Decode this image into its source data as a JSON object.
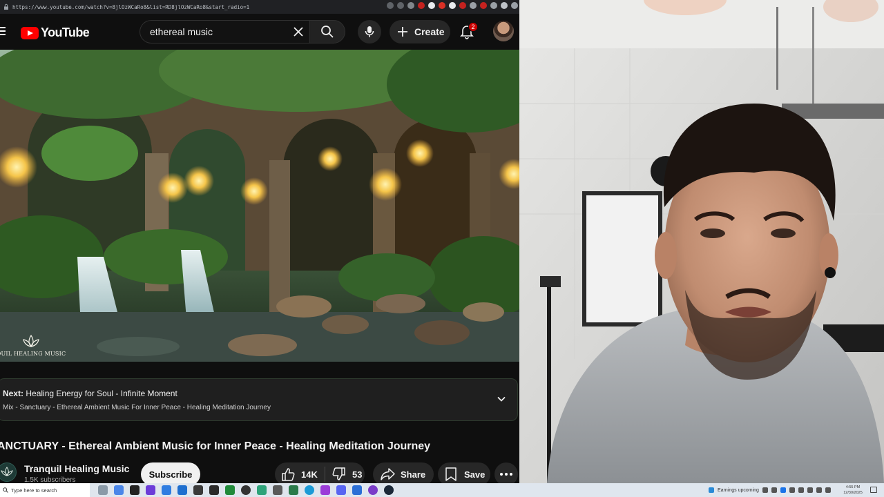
{
  "browser": {
    "url": "https://www.youtube.com/watch?v=8jlOzWCaRo8&list=RD8jlOzWCaRo8&start_radio=1"
  },
  "youtube": {
    "logo_text": "YouTube",
    "search_query": "ethereal music",
    "create_label": "Create",
    "notification_count": "2",
    "player": {
      "watermark_text": "QUIL HEALING MUSIC"
    },
    "up_next": {
      "label": "Next:",
      "title": "Healing Energy for Soul - Infinite Moment",
      "playlist": "Mix - Sanctuary - Ethereal Ambient Music For Inner Peace - Healing Meditation Journey"
    },
    "video_title": "ANCTUARY - Ethereal Ambient Music for Inner Peace - Healing Meditation Journey",
    "channel": {
      "name": "Tranquil Healing Music",
      "subscribers": "1.5K subscribers",
      "subscribe_label": "Subscribe"
    },
    "actions": {
      "likes": "14K",
      "dislikes": "53",
      "share_label": "Share",
      "save_label": "Save"
    }
  },
  "taskbar": {
    "search_placeholder": "Type here to search",
    "tray_text": "Earnings upcoming",
    "time": "4:55 PM",
    "date": "12/30/2025"
  },
  "colors": {
    "youtube_red": "#ff0000",
    "bg_dark": "#0f0f0f",
    "chip_bg": "#272727",
    "badge_red": "#cc0000",
    "taskbar_bg": "#dfe6ee"
  }
}
